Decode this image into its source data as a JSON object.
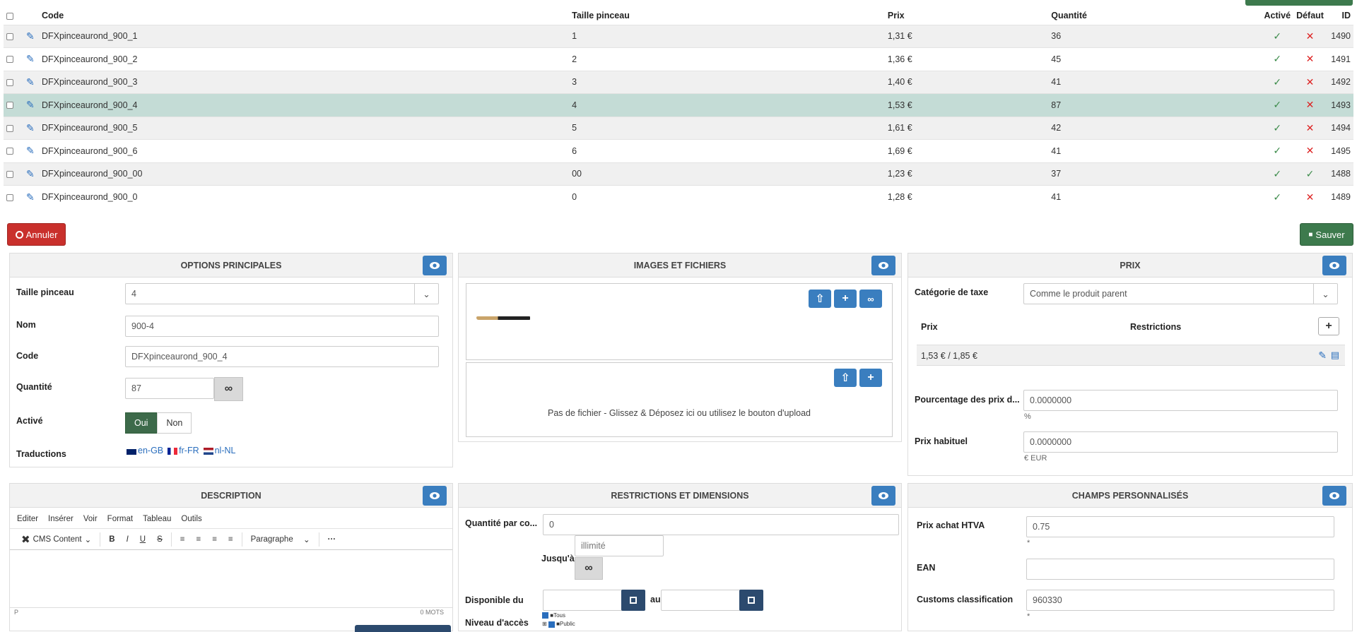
{
  "table": {
    "headers": {
      "code": "Code",
      "taille": "Taille pinceau",
      "prix": "Prix",
      "quantite": "Quantité",
      "active": "Activé",
      "defaut": "Défaut",
      "id": "ID"
    },
    "rows": [
      {
        "code": "DFXpinceaurond_900_1",
        "taille": "1",
        "prix": "1,31 €",
        "quantite": "36",
        "active": true,
        "defaut": false,
        "id": "1490"
      },
      {
        "code": "DFXpinceaurond_900_2",
        "taille": "2",
        "prix": "1,36 €",
        "quantite": "45",
        "active": true,
        "defaut": false,
        "id": "1491"
      },
      {
        "code": "DFXpinceaurond_900_3",
        "taille": "3",
        "prix": "1,40 €",
        "quantite": "41",
        "active": true,
        "defaut": false,
        "id": "1492"
      },
      {
        "code": "DFXpinceaurond_900_4",
        "taille": "4",
        "prix": "1,53 €",
        "quantite": "87",
        "active": true,
        "defaut": false,
        "id": "1493",
        "selected": true
      },
      {
        "code": "DFXpinceaurond_900_5",
        "taille": "5",
        "prix": "1,61 €",
        "quantite": "42",
        "active": true,
        "defaut": false,
        "id": "1494"
      },
      {
        "code": "DFXpinceaurond_900_6",
        "taille": "6",
        "prix": "1,69 €",
        "quantite": "41",
        "active": true,
        "defaut": false,
        "id": "1495"
      },
      {
        "code": "DFXpinceaurond_900_00",
        "taille": "00",
        "prix": "1,23 €",
        "quantite": "37",
        "active": true,
        "defaut": true,
        "id": "1488"
      },
      {
        "code": "DFXpinceaurond_900_0",
        "taille": "0",
        "prix": "1,28 €",
        "quantite": "41",
        "active": true,
        "defaut": false,
        "id": "1489"
      }
    ]
  },
  "actions": {
    "annuler": "Annuler",
    "sauver": "Sauver"
  },
  "options": {
    "title": "OPTIONS PRINCIPALES",
    "taille_label": "Taille pinceau",
    "taille_value": "4",
    "nom_label": "Nom",
    "nom_value": "900-4",
    "code_label": "Code",
    "code_value": "DFXpinceaurond_900_4",
    "quantite_label": "Quantité",
    "quantite_value": "87",
    "active_label": "Activé",
    "oui": "Oui",
    "non": "Non",
    "traductions_label": "Traductions",
    "langs": [
      "en-GB",
      "fr-FR",
      "nl-NL"
    ]
  },
  "images": {
    "title": "IMAGES ET FICHIERS",
    "no_file": "Pas de fichier - Glissez & Déposez ici ou utilisez le bouton d'upload"
  },
  "prix": {
    "title": "PRIX",
    "tax_label": "Catégorie de taxe",
    "tax_value": "Comme le produit parent",
    "col_prix": "Prix",
    "col_restrictions": "Restrictions",
    "price_row": "1,53 € / 1,85 €",
    "pct_label": "Pourcentage des prix d...",
    "pct_value": "0.0000000",
    "pct_unit": "%",
    "habituel_label": "Prix habituel",
    "habituel_value": "0.0000000",
    "habituel_unit": "€ EUR"
  },
  "description": {
    "title": "DESCRIPTION",
    "menu": [
      "Editer",
      "Insérer",
      "Voir",
      "Format",
      "Tableau",
      "Outils"
    ],
    "cms": "CMS Content",
    "paragraph": "Paragraphe",
    "status_p": "P",
    "words": "0 MOTS"
  },
  "restrictions": {
    "title": "RESTRICTIONS ET DIMENSIONS",
    "qte_label": "Quantité par co...",
    "qte_value": "0",
    "jusqua_label": "Jusqu'à",
    "jusqua_placeholder": "illimité",
    "dispo_label": "Disponible du",
    "au": "au",
    "niveau_label": "Niveau d'accès",
    "tree": [
      "Tous",
      "Public"
    ]
  },
  "champs": {
    "title": "CHAMPS PERSONNALISÉS",
    "prix_achat_label": "Prix achat HTVA",
    "prix_achat_value": "0.75",
    "req1": "*",
    "ean_label": "EAN",
    "ean_value": "",
    "customs_label": "Customs classification",
    "customs_value": "960330",
    "req2": "*"
  },
  "colors": {
    "accent": "#3a7ebf",
    "green": "#3d7a4d",
    "red": "#c9302c",
    "selected_row": "#c4dcd6"
  }
}
